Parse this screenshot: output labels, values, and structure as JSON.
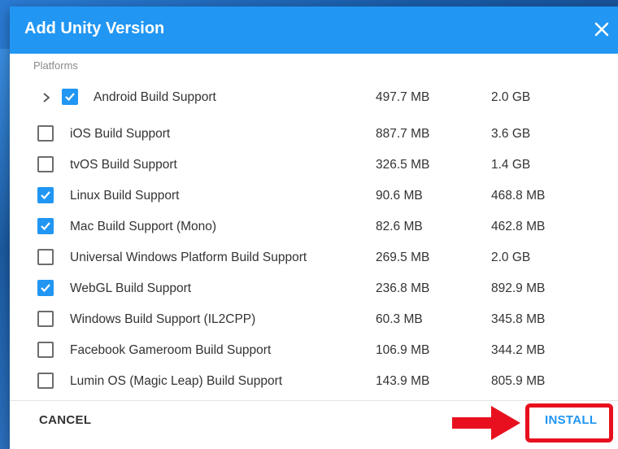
{
  "dialog": {
    "title": "Add Unity Version",
    "section_label": "Platforms"
  },
  "modules": [
    {
      "name": "Android Build Support",
      "download": "497.7 MB",
      "size": "2.0 GB",
      "checked": true,
      "expandable": true
    },
    {
      "name": "iOS Build Support",
      "download": "887.7 MB",
      "size": "3.6 GB",
      "checked": false
    },
    {
      "name": "tvOS Build Support",
      "download": "326.5 MB",
      "size": "1.4 GB",
      "checked": false
    },
    {
      "name": "Linux Build Support",
      "download": "90.6 MB",
      "size": "468.8 MB",
      "checked": true
    },
    {
      "name": "Mac Build Support (Mono)",
      "download": "82.6 MB",
      "size": "462.8 MB",
      "checked": true
    },
    {
      "name": "Universal Windows Platform Build Support",
      "download": "269.5 MB",
      "size": "2.0 GB",
      "checked": false
    },
    {
      "name": "WebGL Build Support",
      "download": "236.8 MB",
      "size": "892.9 MB",
      "checked": true
    },
    {
      "name": "Windows Build Support (IL2CPP)",
      "download": "60.3 MB",
      "size": "345.8 MB",
      "checked": false
    },
    {
      "name": "Facebook Gameroom Build Support",
      "download": "106.9 MB",
      "size": "344.2 MB",
      "checked": false
    },
    {
      "name": "Lumin OS (Magic Leap) Build Support",
      "download": "143.9 MB",
      "size": "805.9 MB",
      "checked": false
    }
  ],
  "footer": {
    "cancel_label": "CANCEL",
    "install_label": "INSTALL"
  },
  "colors": {
    "accent": "#2196f3",
    "highlight": "#e8101e"
  },
  "icons": {
    "close": "close-icon",
    "expand": "chevron-right-icon",
    "check": "check-icon",
    "annotation": "red-arrow-icon"
  }
}
